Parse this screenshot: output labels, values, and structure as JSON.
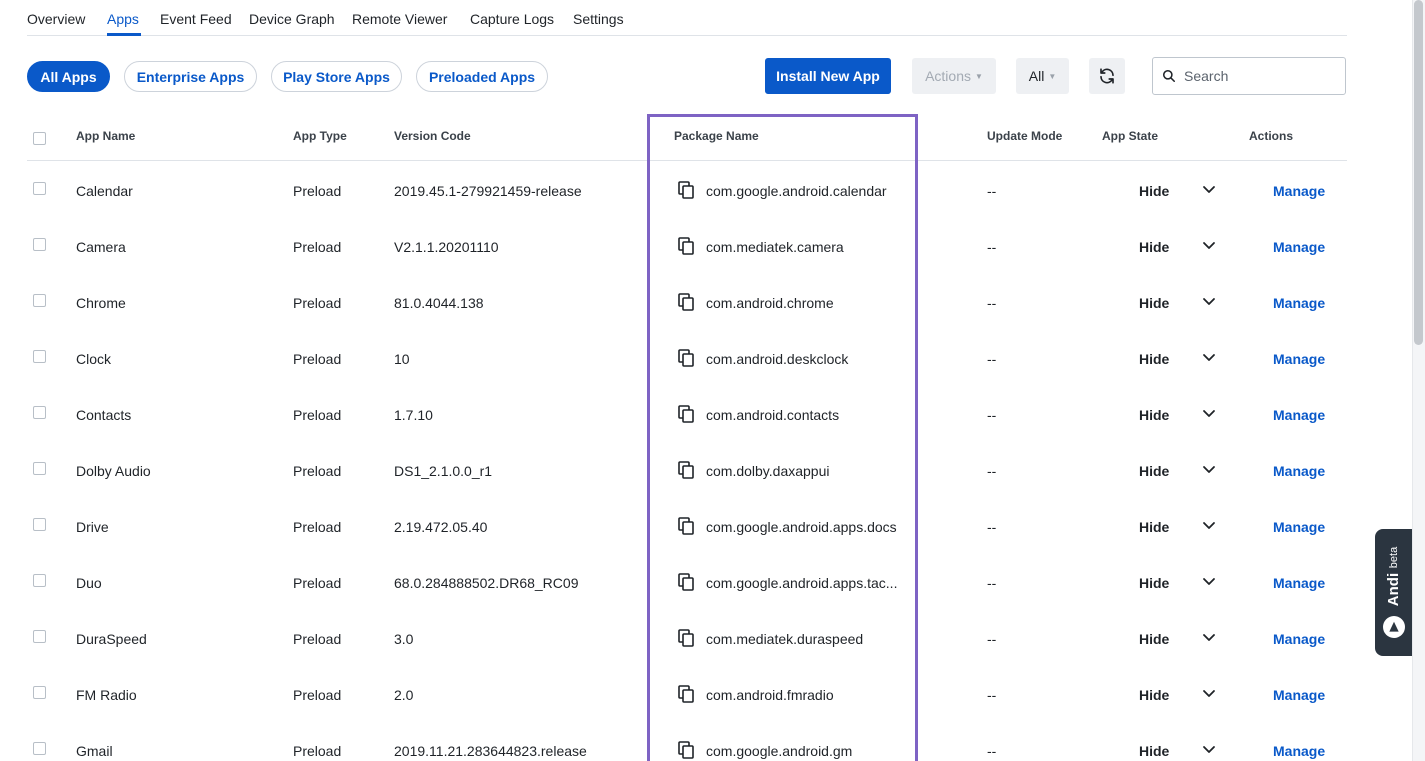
{
  "nav": {
    "tabs": [
      "Overview",
      "Apps",
      "Event Feed",
      "Device Graph",
      "Remote Viewer",
      "Capture Logs",
      "Settings"
    ],
    "active": "Apps"
  },
  "filters": {
    "pills": [
      "All Apps",
      "Enterprise Apps",
      "Play Store Apps",
      "Preloaded Apps"
    ],
    "active": "All Apps"
  },
  "toolbar": {
    "install_label": "Install New App",
    "actions_label": "Actions",
    "filter_label": "All",
    "search_placeholder": "Search"
  },
  "table": {
    "headers": {
      "app_name": "App Name",
      "app_type": "App Type",
      "version_code": "Version Code",
      "package_name": "Package Name",
      "update_mode": "Update Mode",
      "app_state": "App State",
      "actions": "Actions"
    },
    "rows": [
      {
        "name": "Calendar",
        "type": "Preload",
        "version": "2019.45.1-279921459-release",
        "package": "com.google.android.calendar",
        "update_mode": "--",
        "state": "Hide",
        "action": "Manage"
      },
      {
        "name": "Camera",
        "type": "Preload",
        "version": "V2.1.1.20201110",
        "package": "com.mediatek.camera",
        "update_mode": "--",
        "state": "Hide",
        "action": "Manage"
      },
      {
        "name": "Chrome",
        "type": "Preload",
        "version": "81.0.4044.138",
        "package": "com.android.chrome",
        "update_mode": "--",
        "state": "Hide",
        "action": "Manage"
      },
      {
        "name": "Clock",
        "type": "Preload",
        "version": "10",
        "package": "com.android.deskclock",
        "update_mode": "--",
        "state": "Hide",
        "action": "Manage"
      },
      {
        "name": "Contacts",
        "type": "Preload",
        "version": "1.7.10",
        "package": "com.android.contacts",
        "update_mode": "--",
        "state": "Hide",
        "action": "Manage"
      },
      {
        "name": "Dolby Audio",
        "type": "Preload",
        "version": "DS1_2.1.0.0_r1",
        "package": "com.dolby.daxappui",
        "update_mode": "--",
        "state": "Hide",
        "action": "Manage"
      },
      {
        "name": "Drive",
        "type": "Preload",
        "version": "2.19.472.05.40",
        "package": "com.google.android.apps.docs",
        "update_mode": "--",
        "state": "Hide",
        "action": "Manage"
      },
      {
        "name": "Duo",
        "type": "Preload",
        "version": "68.0.284888502.DR68_RC09",
        "package": "com.google.android.apps.tac...",
        "update_mode": "--",
        "state": "Hide",
        "action": "Manage"
      },
      {
        "name": "DuraSpeed",
        "type": "Preload",
        "version": "3.0",
        "package": "com.mediatek.duraspeed",
        "update_mode": "--",
        "state": "Hide",
        "action": "Manage"
      },
      {
        "name": "FM Radio",
        "type": "Preload",
        "version": "2.0",
        "package": "com.android.fmradio",
        "update_mode": "--",
        "state": "Hide",
        "action": "Manage"
      },
      {
        "name": "Gmail",
        "type": "Preload",
        "version": "2019.11.21.283644823.release",
        "package": "com.google.android.gm",
        "update_mode": "--",
        "state": "Hide",
        "action": "Manage"
      }
    ]
  },
  "andi": {
    "name": "Andi",
    "badge": "beta"
  },
  "colors": {
    "accent": "#0a59c9",
    "highlight": "#7e63c4",
    "andi_bg": "#2b3540"
  }
}
